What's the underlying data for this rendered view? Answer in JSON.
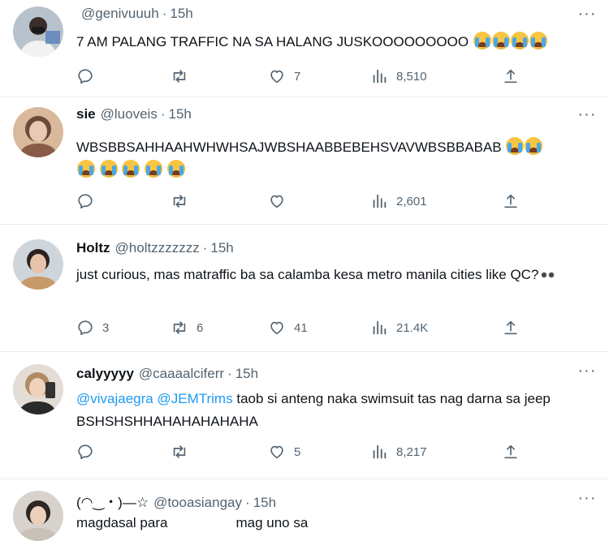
{
  "tweets": [
    {
      "name": "",
      "handle": "@genivuuuh",
      "time": "15h",
      "text": "7 AM PALANG TRAFFIC NA SA HALANG JUSKOOOOOOOOO",
      "emoji_count": 4,
      "replies": "",
      "retweets": "",
      "likes": "7",
      "views": "8,510"
    },
    {
      "name": "sie",
      "handle": "@luoveis",
      "time": "15h",
      "text": "WBSBBSAHHAAHWHWHSAJWBSHAABBEBEHSVAVWBSBBABAB",
      "emoji_count": 7,
      "replies": "",
      "retweets": "",
      "likes": "",
      "views": "2,601"
    },
    {
      "name": "Holtz",
      "handle": "@holtzzzzzzz",
      "time": "15h",
      "text": "just curious, mas matraffic ba sa calamba kesa metro manila cities like QC?",
      "replies": "3",
      "retweets": "6",
      "likes": "41",
      "views": "21.4K"
    },
    {
      "name": "calyyyyy",
      "handle": "@caaaalciferr",
      "time": "15h",
      "mentions": [
        "@vivajaegra",
        "@JEMTrims"
      ],
      "text": "taob si anteng naka swimsuit tas nag darna sa jeep BSHSHSHHAHAHAHAHAHA",
      "replies": "",
      "retweets": "",
      "likes": "5",
      "views": "8,217"
    },
    {
      "name": "(◠‿・)—☆",
      "handle": "@tooasiangay",
      "time": "15h",
      "text_a": "magdasal para",
      "text_b": "mag uno sa"
    }
  ],
  "separator": "·",
  "more_label": "···",
  "icons": [
    "reply-icon",
    "retweet-icon",
    "like-icon",
    "views-icon",
    "share-icon",
    "more-icon",
    "loudly-crying-face-emoji",
    "eyes-emoji"
  ],
  "colors": {
    "text": "#0f1419",
    "secondary": "#536471",
    "link": "#1d9bf0",
    "border": "#e6ecf0"
  }
}
